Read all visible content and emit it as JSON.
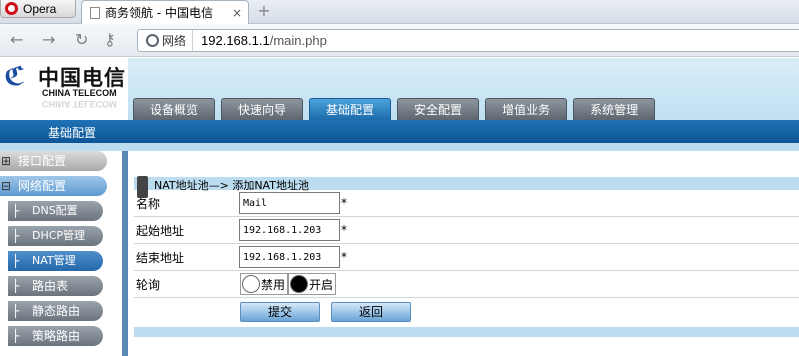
{
  "browser": {
    "menu_label": "Opera",
    "tab_title": "商务领航 - 中国电信",
    "tab_close": "×",
    "new_tab": "+",
    "site_info": "网络",
    "url_host": "192.168.1.1",
    "url_path": "/main.php"
  },
  "header": {
    "logo_cn": "中国电信",
    "logo_en": "CHINA TELECOM",
    "logo_reflection": "CHINA TELECOM",
    "menu": [
      "设备概览",
      "快速向导",
      "基础配置",
      "安全配置",
      "增值业务",
      "系统管理"
    ],
    "active_menu": "基础配置"
  },
  "subnav": {
    "label": "基础配置"
  },
  "sidebar": {
    "items": [
      {
        "label": "接口配置",
        "toggle": "⊞",
        "branch": ""
      },
      {
        "label": "网络配置",
        "toggle": "⊟",
        "branch": ""
      },
      {
        "label": "DNS配置",
        "toggle": "",
        "branch": "├"
      },
      {
        "label": "DHCP管理",
        "toggle": "",
        "branch": "├"
      },
      {
        "label": "NAT管理",
        "toggle": "",
        "branch": "├"
      },
      {
        "label": "路由表",
        "toggle": "",
        "branch": "├"
      },
      {
        "label": "静态路由",
        "toggle": "",
        "branch": "├"
      },
      {
        "label": "策略路由",
        "toggle": "",
        "branch": "├"
      }
    ]
  },
  "content": {
    "breadcrumb": "NAT地址池—> 添加NAT地址池",
    "rows": {
      "name": {
        "label": "名称",
        "value": "Mail",
        "required": "*"
      },
      "start": {
        "label": "起始地址",
        "value": "192.168.1.203",
        "required": "*"
      },
      "end": {
        "label": "结束地址",
        "value": "192.168.1.203",
        "required": "*"
      },
      "polling": {
        "label": "轮询",
        "option_off": "禁用",
        "option_on": "开启",
        "selected": "开启"
      }
    },
    "submit_label": "提交",
    "back_label": "返回"
  }
}
